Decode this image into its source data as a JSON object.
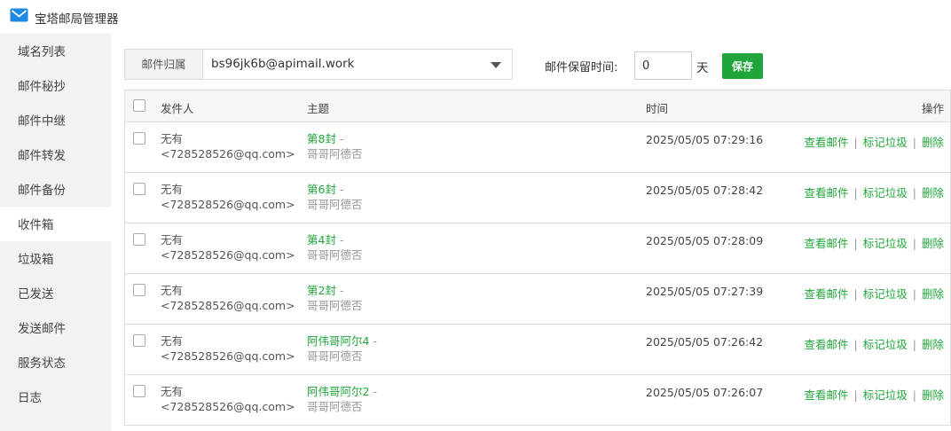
{
  "app": {
    "title": "宝塔邮局管理器"
  },
  "sidebar": {
    "items": [
      {
        "label": "域名列表"
      },
      {
        "label": "邮件秘抄"
      },
      {
        "label": "邮件中继"
      },
      {
        "label": "邮件转发"
      },
      {
        "label": "邮件备份"
      },
      {
        "label": "收件箱",
        "active": true
      },
      {
        "label": "垃圾箱"
      },
      {
        "label": "已发送"
      },
      {
        "label": "发送邮件"
      },
      {
        "label": "服务状态"
      },
      {
        "label": "日志"
      }
    ]
  },
  "toolbar": {
    "owner_label": "邮件归属",
    "owner_value": "bs96jk6b@apimail.work",
    "retention_label": "邮件保留时间:",
    "retention_value": "0",
    "retention_unit": "天",
    "save_label": "保存"
  },
  "table": {
    "headers": {
      "sender": "发件人",
      "subject": "主题",
      "time": "时间",
      "actions": "操作"
    },
    "actions": {
      "view": "查看邮件",
      "spam": "标记垃圾",
      "delete": "删除"
    },
    "rows": [
      {
        "sender_name": "无有",
        "sender_email": "<728528526@qq.com>",
        "subject": "第8封",
        "dash": "-",
        "preview": "哥哥阿德否",
        "time": "2025/05/05 07:29:16"
      },
      {
        "sender_name": "无有",
        "sender_email": "<728528526@qq.com>",
        "subject": "第6封",
        "dash": "-",
        "preview": "哥哥阿德否",
        "time": "2025/05/05 07:28:42"
      },
      {
        "sender_name": "无有",
        "sender_email": "<728528526@qq.com>",
        "subject": "第4封",
        "dash": "-",
        "preview": "哥哥阿德否",
        "time": "2025/05/05 07:28:09"
      },
      {
        "sender_name": "无有",
        "sender_email": "<728528526@qq.com>",
        "subject": "第2封",
        "dash": "-",
        "preview": "哥哥阿德否",
        "time": "2025/05/05 07:27:39"
      },
      {
        "sender_name": "无有",
        "sender_email": "<728528526@qq.com>",
        "subject": "阿伟哥阿尔4",
        "dash": "-",
        "preview": "哥哥阿德否",
        "time": "2025/05/05 07:26:42"
      },
      {
        "sender_name": "无有",
        "sender_email": "<728528526@qq.com>",
        "subject": "阿伟哥阿尔2",
        "dash": "-",
        "preview": "哥哥阿德否",
        "time": "2025/05/05 07:26:07"
      }
    ]
  },
  "colors": {
    "accent": "#20a53a",
    "sidebar_bg": "#f2f2f2",
    "header_bg": "#f6f6f6",
    "icon_blue": "#1e88e5"
  },
  "icons": {
    "app": "mail-icon",
    "owner_dropdown": "chevron-down-icon"
  }
}
